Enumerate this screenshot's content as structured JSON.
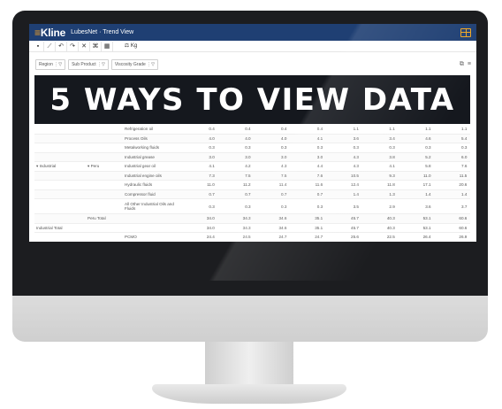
{
  "app": {
    "brand_mark": "≡",
    "brand_name": "Kline",
    "title": "LubesNet · Trend View",
    "layout_icon": "grid-layout-icon"
  },
  "toolbar": {
    "save_icon": "save-icon",
    "chart_icon": "chart-icon",
    "undo_icon": "undo-icon",
    "redo_icon": "redo-icon",
    "expand_icon": "expand-icon",
    "collapse_icon": "collapse-icon",
    "calc_icon": "calculator-icon",
    "units_label": "Kg"
  },
  "filters": {
    "region": "Region",
    "sub_product": "Sub Product",
    "viscosity": "Viscosity Grade"
  },
  "banner": {
    "text": "5 WAYS TO VIEW DATA"
  },
  "table": {
    "group_industrial": "Industrial",
    "group_peru": "Peru",
    "rows": [
      {
        "product": "Refrigeration oil",
        "values": [
          "0.4",
          "0.4",
          "0.4",
          "0.4",
          "1.1",
          "1.1",
          "1.1",
          "1.1"
        ]
      },
      {
        "product": "Process Oils",
        "values": [
          "4.0",
          "4.0",
          "4.0",
          "4.1",
          "3.6",
          "3.4",
          "4.6",
          "5.4"
        ]
      },
      {
        "product": "Metalworking fluids",
        "values": [
          "0.3",
          "0.3",
          "0.3",
          "0.3",
          "0.3",
          "0.3",
          "0.3",
          "0.3"
        ]
      },
      {
        "product": "Industrial grease",
        "values": [
          "3.0",
          "3.0",
          "3.0",
          "3.0",
          "4.3",
          "3.8",
          "5.2",
          "6.0"
        ]
      },
      {
        "product": "Industrial gear oil",
        "values": [
          "4.1",
          "4.2",
          "4.3",
          "4.4",
          "4.3",
          "4.1",
          "5.8",
          "7.6"
        ]
      },
      {
        "product": "Industrial engine oils",
        "values": [
          "7.3",
          "7.5",
          "7.5",
          "7.6",
          "10.5",
          "9.3",
          "11.0",
          "11.5"
        ]
      },
      {
        "product": "Hydraulic fluids",
        "values": [
          "11.0",
          "11.2",
          "11.4",
          "11.6",
          "12.4",
          "11.8",
          "17.1",
          "20.6"
        ]
      },
      {
        "product": "Compressor fluid",
        "values": [
          "0.7",
          "0.7",
          "0.7",
          "0.7",
          "1.4",
          "1.3",
          "1.4",
          "1.4"
        ]
      },
      {
        "product": "All Other Industrial Oils and Fluids",
        "values": [
          "0.3",
          "0.3",
          "0.3",
          "0.3",
          "3.5",
          "2.9",
          "3.6",
          "3.7"
        ]
      }
    ],
    "peru_total_label": "Peru Total",
    "peru_total": [
      "34.0",
      "34.3",
      "34.6",
      "35.1",
      "45.7",
      "40.3",
      "53.1",
      "60.6"
    ],
    "industrial_total_label": "Industrial Total",
    "industrial_total": [
      "34.0",
      "34.3",
      "34.6",
      "35.1",
      "45.7",
      "40.3",
      "53.1",
      "60.6"
    ],
    "tail_rows": [
      {
        "product": "PCMO",
        "values": [
          "24.4",
          "24.5",
          "24.7",
          "24.7",
          "25.6",
          "22.5",
          "26.4",
          "26.9"
        ]
      },
      {
        "product": "Grease",
        "values": [
          "0.8",
          "0.8",
          "0.9",
          "0.9",
          "0.7",
          "0.6",
          "0.8",
          "0.9"
        ]
      }
    ]
  }
}
